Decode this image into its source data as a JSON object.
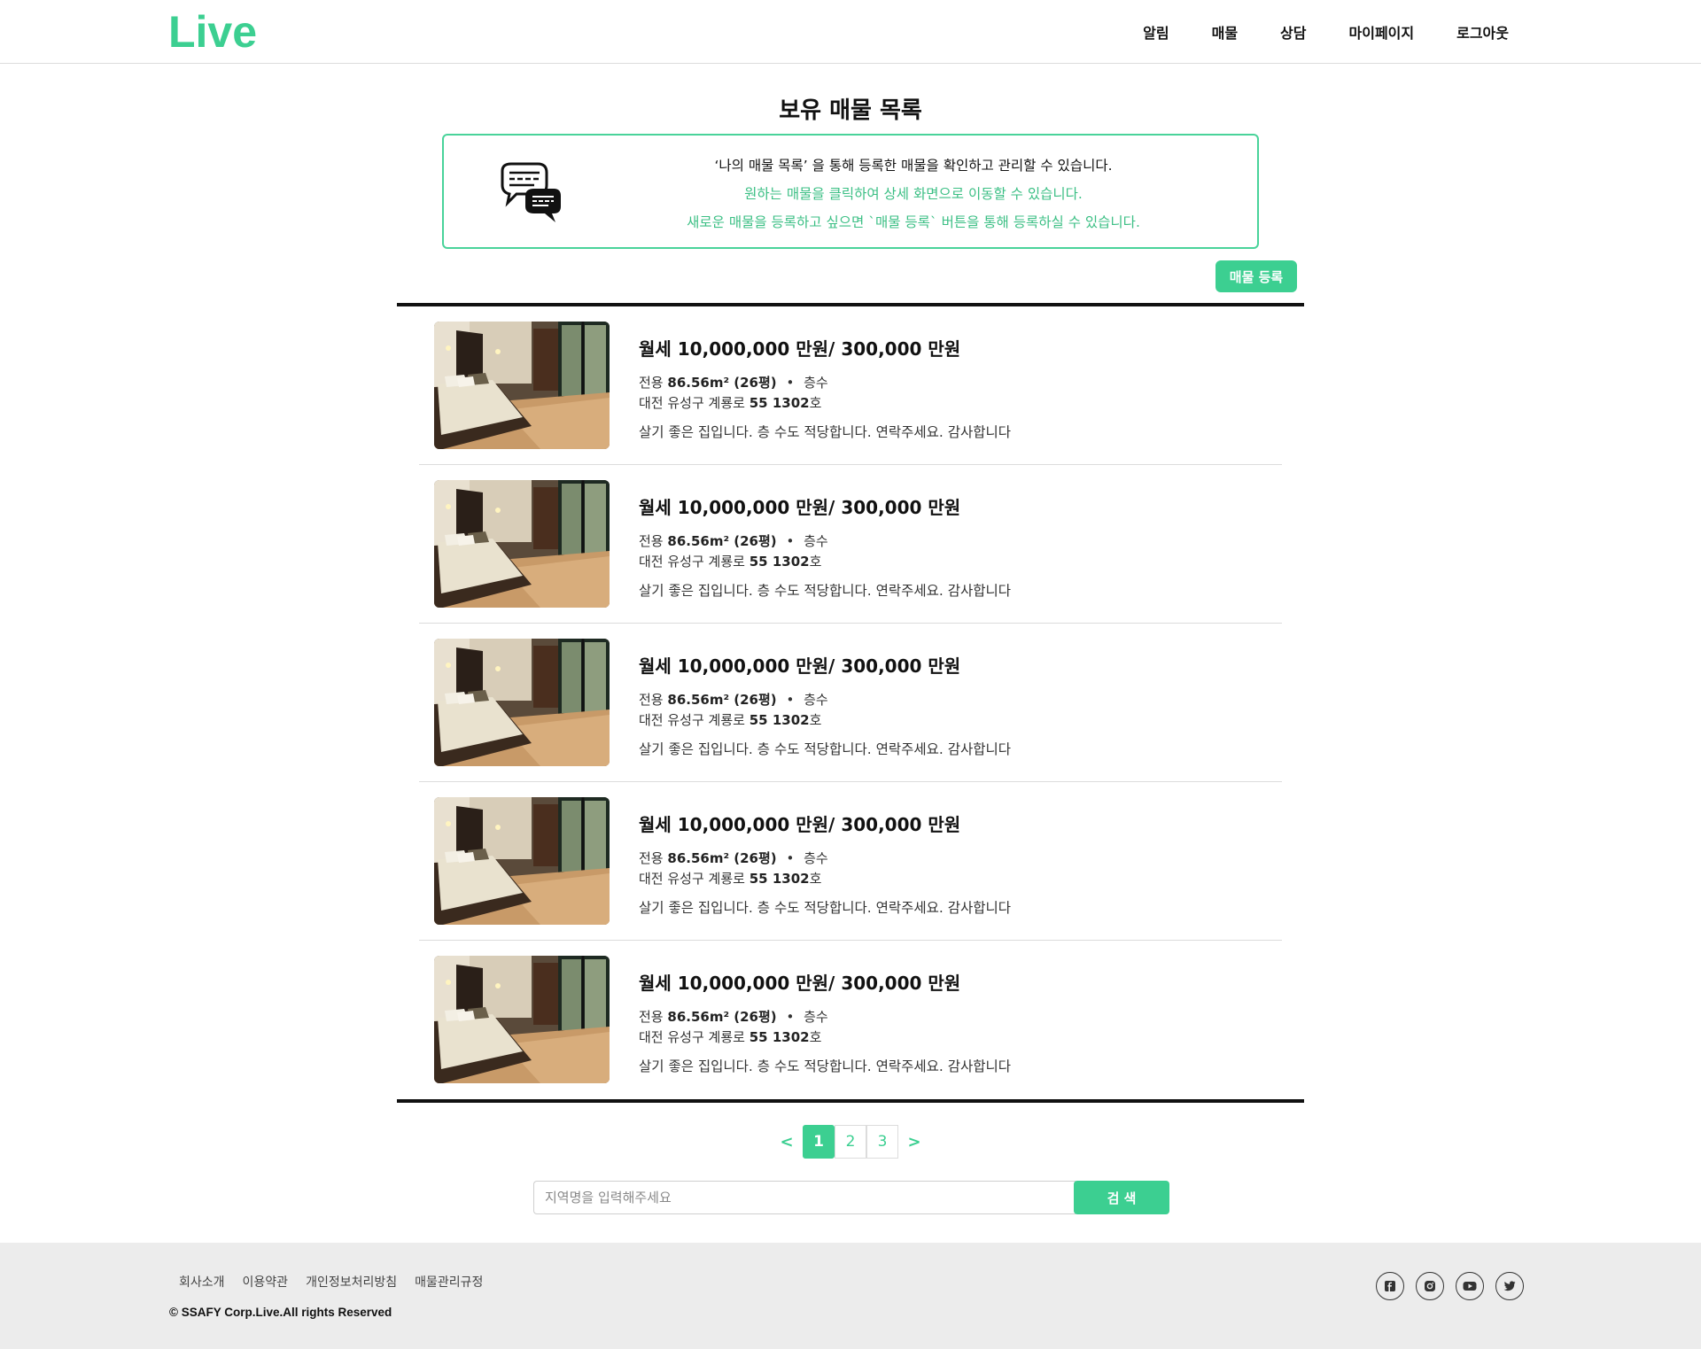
{
  "header": {
    "logo": "Live",
    "nav": [
      "알림",
      "매물",
      "상담",
      "마이페이지",
      "로그아웃"
    ]
  },
  "page": {
    "title": "보유 매물 목록"
  },
  "info": {
    "line1": "‘나의 매물 목록’ 을 통해 등록한 매물을 확인하고 관리할 수 있습니다.",
    "line2": "원하는 매물을 클릭하여 상세 화면으로 이동할 수 있습니다.",
    "line3": "새로운 매물을 등록하고 싶으면 `매물 등록` 버튼을 통해 등록하실 수 있습니다."
  },
  "register_button": "매물 등록",
  "listings": [
    {
      "price": "월세 10,000,000 만원/ 300,000 만원",
      "area_prefix": "전용",
      "area": "86.56m² (26평)",
      "dot": "•",
      "floor": "층수",
      "addr_prefix": "대전 유성구 계룡로",
      "addr_num": "55 1302",
      "addr_suffix": "호",
      "desc": "살기 좋은 집입니다. 층 수도 적당합니다. 연락주세요. 감사합니다"
    },
    {
      "price": "월세 10,000,000 만원/ 300,000 만원",
      "area_prefix": "전용",
      "area": "86.56m² (26평)",
      "dot": "•",
      "floor": "층수",
      "addr_prefix": "대전 유성구 계룡로",
      "addr_num": "55 1302",
      "addr_suffix": "호",
      "desc": "살기 좋은 집입니다. 층 수도 적당합니다. 연락주세요. 감사합니다"
    },
    {
      "price": "월세 10,000,000 만원/ 300,000 만원",
      "area_prefix": "전용",
      "area": "86.56m² (26평)",
      "dot": "•",
      "floor": "층수",
      "addr_prefix": "대전 유성구 계룡로",
      "addr_num": "55 1302",
      "addr_suffix": "호",
      "desc": "살기 좋은 집입니다. 층 수도 적당합니다. 연락주세요. 감사합니다"
    },
    {
      "price": "월세 10,000,000 만원/ 300,000 만원",
      "area_prefix": "전용",
      "area": "86.56m² (26평)",
      "dot": "•",
      "floor": "층수",
      "addr_prefix": "대전 유성구 계룡로",
      "addr_num": "55 1302",
      "addr_suffix": "호",
      "desc": "살기 좋은 집입니다. 층 수도 적당합니다. 연락주세요. 감사합니다"
    },
    {
      "price": "월세 10,000,000 만원/ 300,000 만원",
      "area_prefix": "전용",
      "area": "86.56m² (26평)",
      "dot": "•",
      "floor": "층수",
      "addr_prefix": "대전 유성구 계룡로",
      "addr_num": "55 1302",
      "addr_suffix": "호",
      "desc": "살기 좋은 집입니다. 층 수도 적당합니다. 연락주세요. 감사합니다"
    }
  ],
  "pagination": {
    "prev": "<",
    "pages": [
      "1",
      "2",
      "3"
    ],
    "current": "1",
    "next": ">"
  },
  "search": {
    "placeholder": "지역명을 입력해주세요",
    "button": "검 색"
  },
  "footer": {
    "links": [
      "회사소개",
      "이용약관",
      "개인정보처리방침",
      "매물관리규정"
    ],
    "copyright": "© SSAFY Corp.Live.All rights Reserved",
    "social_icons": [
      "facebook-icon",
      "instagram-icon",
      "youtube-icon",
      "twitter-icon"
    ]
  },
  "colors": {
    "accent": "#3ccf91",
    "info_green": "#3bbf84",
    "footer_bg": "#ececec"
  }
}
